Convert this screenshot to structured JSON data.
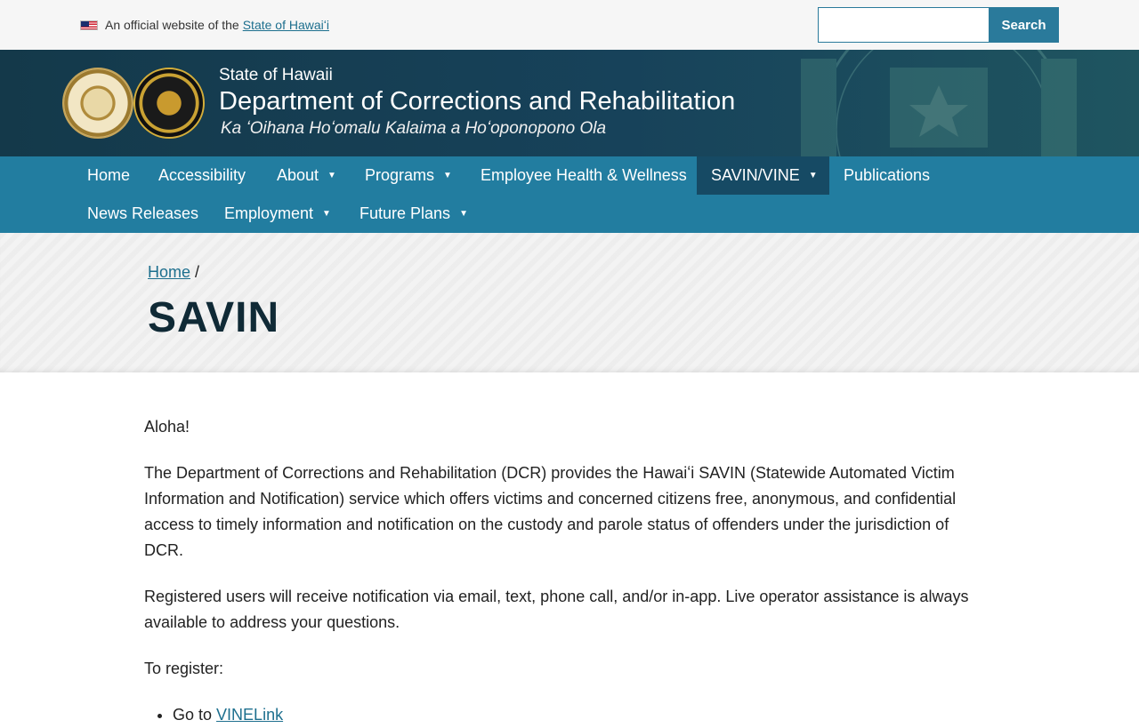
{
  "topbar": {
    "official_text": "An official website of the",
    "official_link": "State of Hawaiʻi",
    "search_placeholder": "",
    "search_button": "Search"
  },
  "header": {
    "state": "State of Hawaii",
    "department": "Department of Corrections and Rehabilitation",
    "subtitle": "Ka ʻOihana Hoʻomalu Kalaima a Hoʻoponopono Ola"
  },
  "nav": {
    "items": [
      {
        "label": "Home"
      },
      {
        "label": "Accessibility"
      },
      {
        "label": "About"
      },
      {
        "label": "Programs"
      },
      {
        "label": "Employee Health & Wellness"
      },
      {
        "label": "SAVIN/VINE"
      },
      {
        "label": "Publications"
      },
      {
        "label": "News Releases"
      },
      {
        "label": "Employment"
      },
      {
        "label": "Future Plans"
      }
    ]
  },
  "banner": {
    "breadcrumb_home": "Home",
    "breadcrumb_sep": "/",
    "title": "SAVIN"
  },
  "content": {
    "greeting": "Aloha!",
    "para1": "The Department of Corrections and Rehabilitation (DCR) provides the Hawaiʻi SAVIN (Statewide Automated Victim Information and Notification) service which offers victims and concerned citizens free, anonymous, and confidential access to timely information and notification on the custody and parole status of offenders under the jurisdiction of DCR.",
    "para2": "Registered users will receive notification via email, text, phone call, and/or in-app. Live operator assistance is always available to address your questions.",
    "register_label": "To register:",
    "list_item_prefix": "Go to",
    "list_item_link": "VINELink"
  },
  "colors": {
    "header_bg": "#17425a",
    "nav_bg": "#227da0",
    "nav_active": "#164a64",
    "link": "#1d6f8e"
  }
}
